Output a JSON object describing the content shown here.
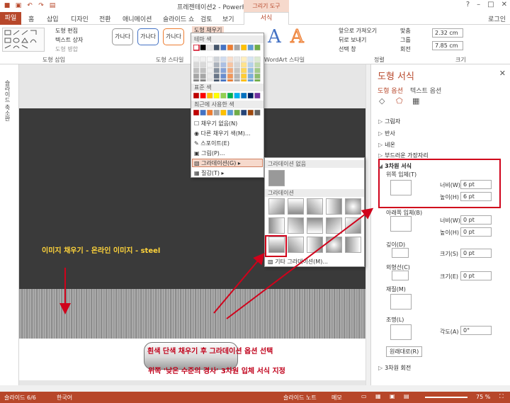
{
  "window": {
    "title": "프레젠테이션2 - PowerPoint",
    "context_tools": "그리기 도구",
    "login": "로그인"
  },
  "tabs": [
    "파일",
    "홈",
    "삽입",
    "디자인",
    "전환",
    "애니메이션",
    "슬라이드 쇼",
    "검토",
    "보기",
    "서식"
  ],
  "ribbon": {
    "edit_shape": "도형 편집",
    "text_box": "텍스트 상자",
    "merge_shapes": "도형 병합",
    "insert_shapes_label": "도형 삽입",
    "style_sample": "가나다",
    "shape_styles_label": "도형 스타일",
    "shape_fill": "도형 채우기",
    "wordart_label": "WordArt 스타일",
    "bring_forward": "앞으로 가져오기",
    "send_backward": "뒤로 보내기",
    "selection_pane": "선택 창",
    "arrange_label": "정렬",
    "align": "맞춤",
    "group": "그룹",
    "rotate": "회전",
    "height": "2.32 cm",
    "width": "7.85 cm",
    "size_label": "크기"
  },
  "fill_menu": {
    "theme_colors": "테마 색",
    "standard_colors": "표준 색",
    "recent_colors": "최근에 사용한 색",
    "no_fill": "채우기 없음(N)",
    "more_colors": "다른 채우기 색(M)...",
    "eyedropper": "스포이트(E)",
    "picture": "그림(P)...",
    "gradient": "그라데이션(G)",
    "texture": "질감(T)"
  },
  "grad_menu": {
    "no_gradient": "그라데이션 없음",
    "gradient": "그라데이션",
    "more_gradients": "기타 그라데이션(M)..."
  },
  "thumbs_label": "슬라이드 축소판",
  "annotations": {
    "fill_note": "이미지 채우기 - 온라인 이미지 - steel",
    "gradient_note": "흰색 단색 채우기 후 그라데이션 옵션 선택",
    "bevel_note": "위쪽 '낮은 수준의 경사' 3차원 입체 서식 지정"
  },
  "pane": {
    "title": "도형 서식",
    "tab_shape": "도형 옵션",
    "tab_text": "텍스트 옵션",
    "sections": [
      "그림자",
      "반사",
      "네온",
      "부드러운 가장자리",
      "3차원 서식",
      "3차원 회전"
    ],
    "top_bevel": "위쪽 입체(T)",
    "bottom_bevel": "아래쪽 입체(B)",
    "width_label": "너비(W)",
    "height_label": "높이(H)",
    "top_width": "6 pt",
    "top_height": "6 pt",
    "bottom_width": "0 pt",
    "bottom_height": "0 pt",
    "depth": "깊이(D)",
    "depth_size_label": "크기(S)",
    "depth_size": "0 pt",
    "contour": "외형선(C)",
    "contour_size_label": "크기(E)",
    "contour_size": "0 pt",
    "material": "재질(M)",
    "lighting": "조명(L)",
    "angle_label": "각도(A)",
    "angle": "0°",
    "reset": "원래대로(R)"
  },
  "status": {
    "slide": "슬라이드 6/6",
    "language": "한국어",
    "notes": "슬라이드 노트",
    "comments": "메모",
    "zoom": "75 %"
  },
  "colors": {
    "accent": "#b7472a",
    "highlight": "#d0021b",
    "annotation_yellow": "#ffd43b",
    "annotation_red": "#c0001a"
  }
}
